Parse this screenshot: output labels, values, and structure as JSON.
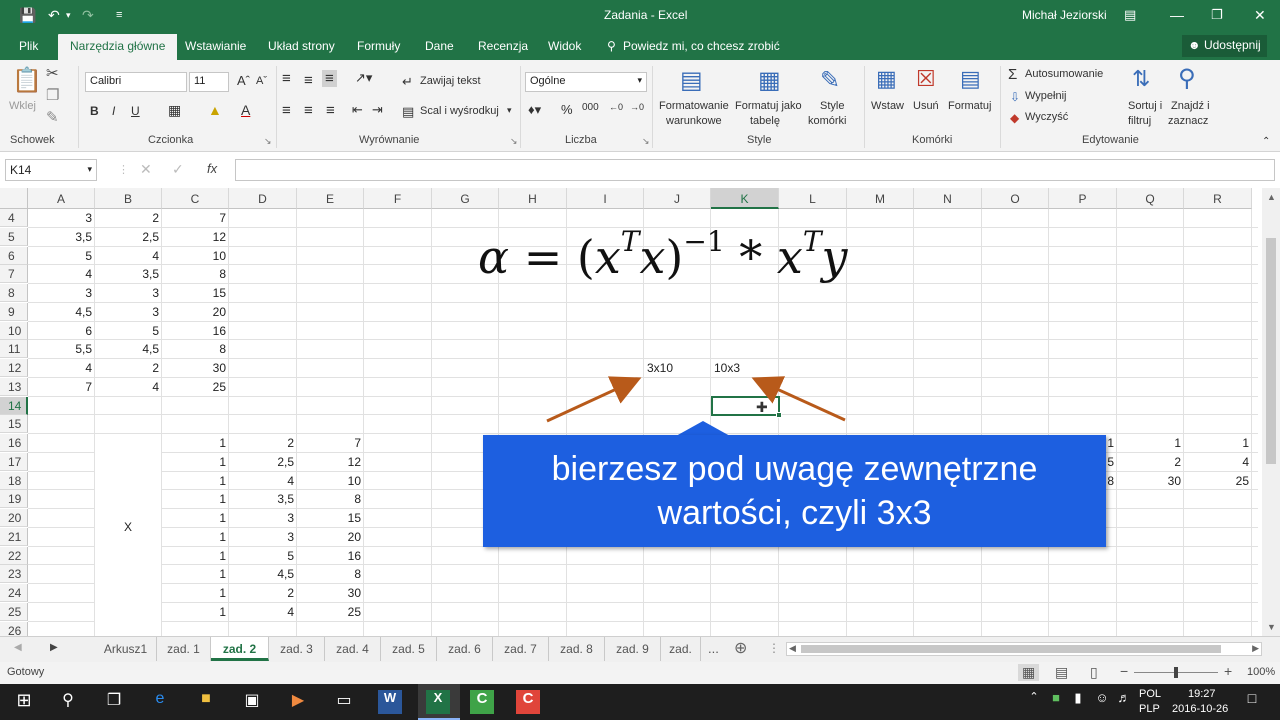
{
  "window": {
    "title": "Zadania - Excel",
    "user": "Michał Jeziorski",
    "share": "Udostępnij"
  },
  "menu": {
    "tabs": [
      "Plik",
      "Narzędzia główne",
      "Wstawianie",
      "Układ strony",
      "Formuły",
      "Dane",
      "Recenzja",
      "Widok"
    ],
    "tell_me": "Powiedz mi, co chcesz zrobić"
  },
  "ribbon": {
    "groups": [
      "Schowek",
      "Czcionka",
      "Wyrównanie",
      "Liczba",
      "Style",
      "Komórki",
      "Edytowanie"
    ],
    "paste": "Wklej",
    "font_name": "Calibri",
    "font_size": "11",
    "wrap_text": "Zawijaj tekst",
    "merge_center": "Scal i wyśrodkuj",
    "number_format": "Ogólne",
    "cond_format": [
      "Formatowanie",
      "warunkowe"
    ],
    "format_table": [
      "Formatuj jako",
      "tabelę"
    ],
    "cell_styles": [
      "Style",
      "komórki"
    ],
    "insert": "Wstaw",
    "delete": "Usuń",
    "format": "Formatuj",
    "autosum": "Autosumowanie",
    "fill": "Wypełnij",
    "clear": "Wyczyść",
    "sort": [
      "Sortuj i",
      "filtruj"
    ],
    "find": [
      "Znajdź i",
      "zaznacz"
    ]
  },
  "formula_bar": {
    "name_box": "K14",
    "fx": "fx",
    "formula": ""
  },
  "grid": {
    "columns": [
      "A",
      "B",
      "C",
      "D",
      "E",
      "F",
      "G",
      "H",
      "I",
      "J",
      "K",
      "L",
      "M",
      "N",
      "O",
      "P",
      "Q",
      "R"
    ],
    "rows": [
      "4",
      "5",
      "6",
      "7",
      "8",
      "9",
      "10",
      "11",
      "12",
      "13",
      "14",
      "15",
      "16",
      "17",
      "18",
      "19",
      "20",
      "21",
      "22",
      "23",
      "24",
      "25",
      "26"
    ],
    "top_block": [
      [
        "3",
        "2",
        "7"
      ],
      [
        "3,5",
        "2,5",
        "12"
      ],
      [
        "5",
        "4",
        "10"
      ],
      [
        "4",
        "3,5",
        "8"
      ],
      [
        "3",
        "3",
        "15"
      ],
      [
        "4,5",
        "3",
        "20"
      ],
      [
        "6",
        "5",
        "16"
      ],
      [
        "5,5",
        "4,5",
        "8"
      ],
      [
        "4",
        "2",
        "30"
      ],
      [
        "7",
        "4",
        "25"
      ]
    ],
    "x_block": [
      [
        "1",
        "2",
        "7"
      ],
      [
        "1",
        "2,5",
        "12"
      ],
      [
        "1",
        "4",
        "10"
      ],
      [
        "1",
        "3,5",
        "8"
      ],
      [
        "1",
        "3",
        "15"
      ],
      [
        "1",
        "3",
        "20"
      ],
      [
        "1",
        "5",
        "16"
      ],
      [
        "1",
        "4,5",
        "8"
      ],
      [
        "1",
        "2",
        "30"
      ],
      [
        "1",
        "4",
        "25"
      ]
    ],
    "x_label": "X",
    "right_block": [
      [
        "1",
        "1",
        "1"
      ],
      [
        "5",
        "2",
        "4"
      ],
      [
        "8",
        "30",
        "25"
      ]
    ],
    "j12": "3x10",
    "k12": "10x3"
  },
  "overlay": {
    "formula": {
      "alpha": "α",
      "eq": "=",
      "lp": "(",
      "x1": "x",
      "t1": "T",
      "x2": "x",
      "rp": ")",
      "m1": "−1",
      "star": "*",
      "x3": "x",
      "t2": "T",
      "y": "y"
    },
    "callout_line1": "bierzesz pod uwagę zewnętrzne",
    "callout_line2": "wartości, czyli 3x3",
    "arrow_color": "#b85a1a"
  },
  "sheet_tabs": [
    "Arkusz1",
    "zad. 1",
    "zad. 2",
    "zad. 3",
    "zad. 4",
    "zad. 5",
    "zad. 6",
    "zad. 7",
    "zad. 8",
    "zad. 9",
    "zad."
  ],
  "sheet_tab_more": "...",
  "active_tab": "zad. 2",
  "status": {
    "ready": "Gotowy",
    "zoom": "100%"
  },
  "taskbar": {
    "lang": "POL",
    "layout": "PLP",
    "time": "19:27",
    "date": "2016-10-26"
  },
  "colors": {
    "excel_green": "#217346",
    "callout_blue": "#1d5fe0",
    "arrow": "#b85a1a"
  }
}
